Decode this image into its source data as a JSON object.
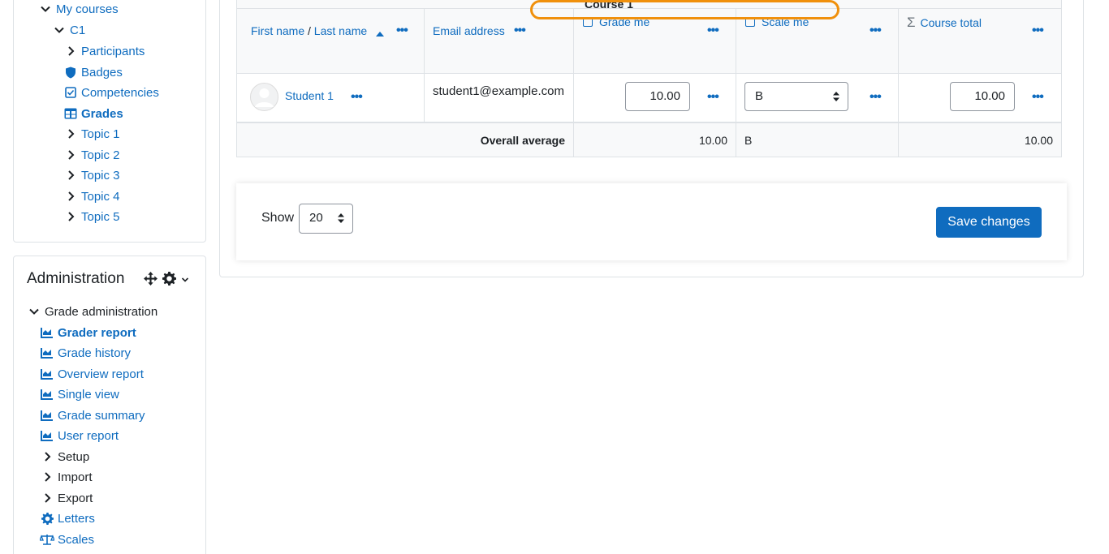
{
  "nav": {
    "my_courses": "My courses",
    "course": "C1",
    "items": [
      {
        "label": "Participants"
      },
      {
        "label": "Badges"
      },
      {
        "label": "Competencies"
      },
      {
        "label": "Grades"
      },
      {
        "label": "Topic 1"
      },
      {
        "label": "Topic 2"
      },
      {
        "label": "Topic 3"
      },
      {
        "label": "Topic 4"
      },
      {
        "label": "Topic 5"
      }
    ]
  },
  "admin": {
    "title": "Administration",
    "grade_admin": "Grade administration",
    "items": [
      {
        "label": "Grader report"
      },
      {
        "label": "Grade history"
      },
      {
        "label": "Overview report"
      },
      {
        "label": "Single view"
      },
      {
        "label": "Grade summary"
      },
      {
        "label": "User report"
      },
      {
        "label": "Setup"
      },
      {
        "label": "Import"
      },
      {
        "label": "Export"
      },
      {
        "label": "Letters"
      },
      {
        "label": "Scales"
      }
    ]
  },
  "table": {
    "category": "Course 1",
    "headers": {
      "first_name": "First name",
      "separator": "/",
      "last_name": "Last name",
      "email": "Email address",
      "grade_me": "Grade me",
      "scale_me": "Scale me",
      "course_total": "Course total"
    },
    "row": {
      "student": "Student 1",
      "email": "student1@example.com",
      "grade_me": "10.00",
      "scale_me": "B",
      "course_total": "10.00"
    },
    "average": {
      "label": "Overall average",
      "grade_me": "10.00",
      "scale_me": "B",
      "course_total": "10.00"
    },
    "sigma": "Σ",
    "dots": "•••"
  },
  "footer": {
    "show_label": "Show",
    "per_page": "20",
    "save_label": "Save changes"
  },
  "colors": {
    "link": "#0f6cbf",
    "highlight": "#f0900c"
  }
}
